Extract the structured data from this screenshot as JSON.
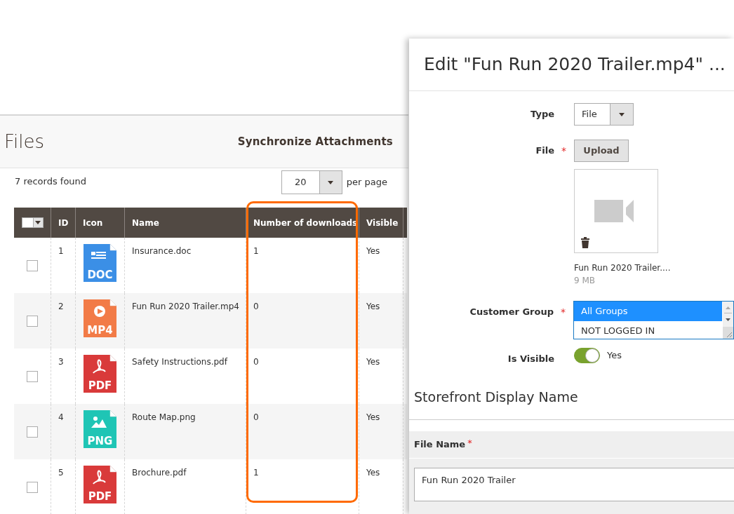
{
  "files_panel": {
    "title": "Files",
    "sync_button": "Synchronize Attachments",
    "records_found": "7 records found",
    "per_page": {
      "value": "20",
      "label": "per page"
    },
    "table": {
      "columns": [
        "ID",
        "Icon",
        "Name",
        "Number of downloads",
        "Visible"
      ],
      "rows": [
        {
          "checked": false,
          "id": "1",
          "icon": {
            "kind": "doc",
            "label": "DOC",
            "color": "#3b8fe6"
          },
          "name": "Insurance.doc",
          "downloads": "1",
          "visible": "Yes"
        },
        {
          "checked": false,
          "id": "2",
          "icon": {
            "kind": "video",
            "label": "MP4",
            "color": "#f27b47"
          },
          "name": "Fun Run 2020 Trailer.mp4",
          "downloads": "0",
          "visible": "Yes"
        },
        {
          "checked": false,
          "id": "3",
          "icon": {
            "kind": "pdf",
            "label": "PDF",
            "color": "#d93a3a"
          },
          "name": "Safety Instructions.pdf",
          "downloads": "0",
          "visible": "Yes"
        },
        {
          "checked": false,
          "id": "4",
          "icon": {
            "kind": "image",
            "label": "PNG",
            "color": "#1fc5b5"
          },
          "name": "Route Map.png",
          "downloads": "0",
          "visible": "Yes"
        },
        {
          "checked": false,
          "id": "5",
          "icon": {
            "kind": "pdf",
            "label": "PDF",
            "color": "#d93a3a"
          },
          "name": "Brochure.pdf",
          "downloads": "1",
          "visible": "Yes"
        }
      ]
    }
  },
  "edit_modal": {
    "title": "Edit \"Fun Run 2020 Trailer.mp4\" ...",
    "type_field": {
      "label": "Type",
      "value": "File"
    },
    "file_field": {
      "label": "File",
      "required_mark": "*",
      "upload_button": "Upload",
      "file_name": "Fun Run 2020 Trailer....",
      "file_size": "9 MB"
    },
    "customer_group": {
      "label": "Customer Group",
      "required_mark": "*",
      "options": [
        {
          "label": "All Groups",
          "selected": true
        },
        {
          "label": "NOT LOGGED IN",
          "selected": false
        }
      ]
    },
    "is_visible": {
      "label": "Is Visible",
      "on": true,
      "value_label": "Yes"
    },
    "section_title": "Storefront Display Name",
    "file_name_field": {
      "label": "File Name",
      "required_mark": "*",
      "value": "Fun Run 2020 Trailer"
    }
  }
}
